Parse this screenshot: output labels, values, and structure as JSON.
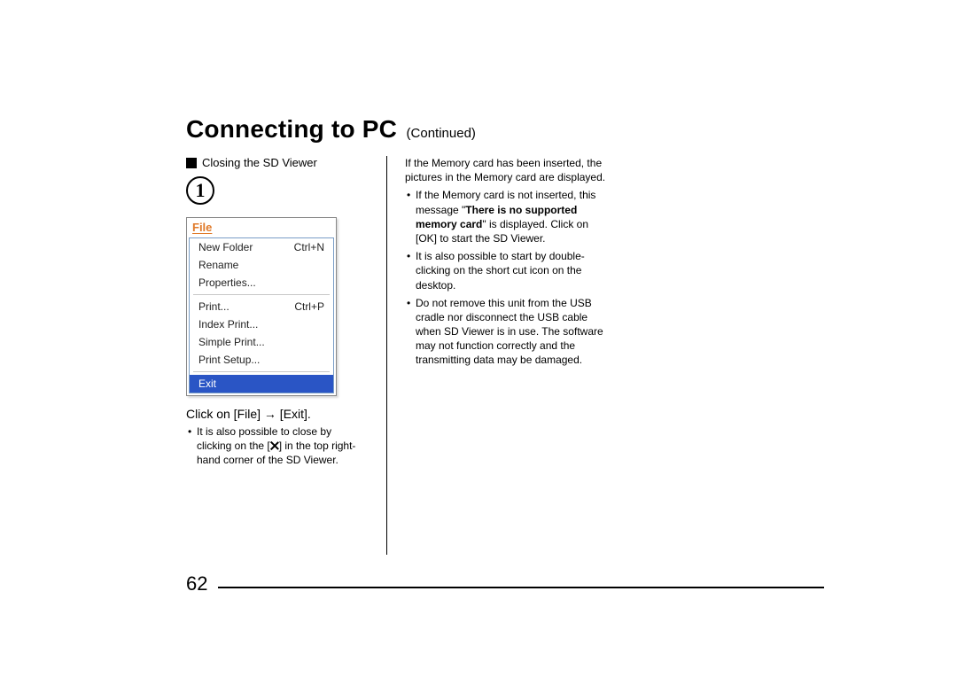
{
  "title": {
    "main": "Connecting to PC",
    "suffix": "(Continued)"
  },
  "section": {
    "label": "Closing the SD Viewer"
  },
  "step": {
    "number": "1"
  },
  "menu": {
    "title": "File",
    "groups": [
      [
        {
          "label": "New Folder",
          "shortcut": "Ctrl+N"
        },
        {
          "label": "Rename",
          "shortcut": ""
        },
        {
          "label": "Properties...",
          "shortcut": ""
        }
      ],
      [
        {
          "label": "Print...",
          "shortcut": "Ctrl+P"
        },
        {
          "label": "Index Print...",
          "shortcut": ""
        },
        {
          "label": "Simple Print...",
          "shortcut": ""
        },
        {
          "label": "Print Setup...",
          "shortcut": ""
        }
      ],
      [
        {
          "label": "Exit",
          "shortcut": "",
          "selected": true
        }
      ]
    ]
  },
  "left": {
    "instruction_pre": "Click on [File] ",
    "instruction_arrow": "→",
    "instruction_post": " [Exit].",
    "bullet_pre": "It is also possible to close by clicking on the [",
    "bullet_post": "] in the top right-hand corner of the SD Viewer."
  },
  "right": {
    "intro": "If the Memory card has been inserted, the pictures in the Memory card are displayed.",
    "b1_pre": "If the Memory card is not inserted, this message \"",
    "b1_bold": "There is no supported memory card",
    "b1_post": "\" is displayed. Click on [OK] to start the SD Viewer.",
    "b2": "It is also possible to start by double-clicking on the short cut icon on the desktop.",
    "b3": "Do not remove this unit from the USB cradle nor disconnect the USB cable when SD Viewer is in use. The software may not function correctly and the transmitting data may be damaged."
  },
  "page_number": "62"
}
